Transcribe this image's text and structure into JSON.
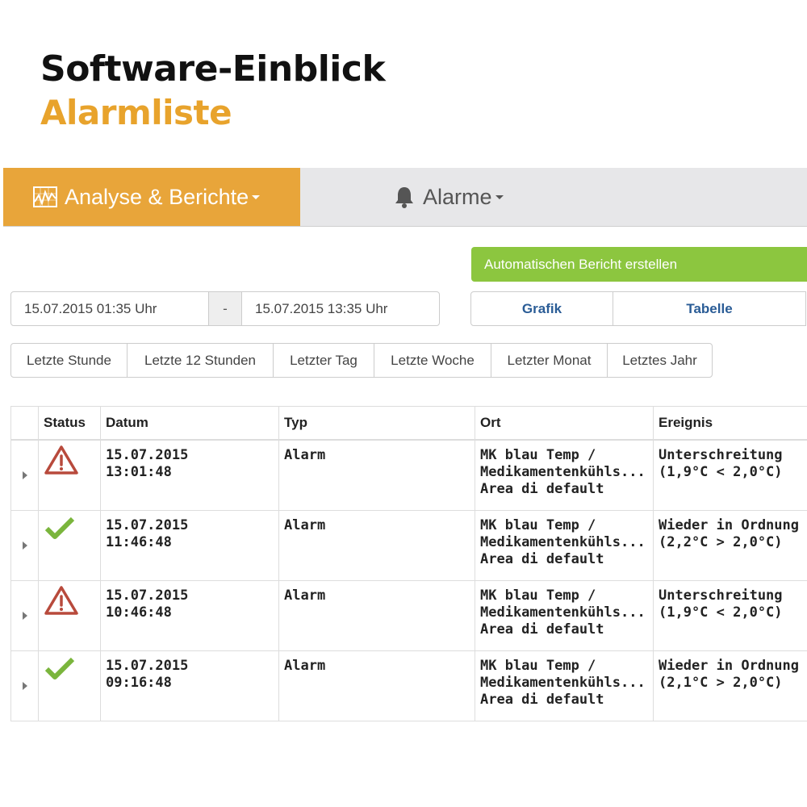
{
  "heading": {
    "title": "Software-Einblick",
    "subtitle": "Alarmliste"
  },
  "colors": {
    "accent": "#e8a53a",
    "green": "#8cc63f",
    "warning": "#b84a3c",
    "ok": "#7ab53c",
    "link": "#2a5c96"
  },
  "nav": {
    "analyse": {
      "label": "Analyse & Berichte",
      "icon": "chart-icon"
    },
    "alarme": {
      "label": "Alarme",
      "icon": "bell-icon"
    }
  },
  "report_button": "Automatischen Bericht erstellen",
  "date_range": {
    "from": "15.07.2015 01:35 Uhr",
    "separator": "-",
    "to": "15.07.2015 13:35 Uhr"
  },
  "view_toggle": {
    "grafik": "Grafik",
    "tabelle": "Tabelle"
  },
  "ranges": [
    "Letzte Stunde",
    "Letzte 12 Stunden",
    "Letzter Tag",
    "Letzte Woche",
    "Letzter Monat",
    "Letztes Jahr"
  ],
  "table": {
    "headers": {
      "status": "Status",
      "datum": "Datum",
      "typ": "Typ",
      "ort": "Ort",
      "ereignis": "Ereignis"
    },
    "rows": [
      {
        "status": "warning-icon",
        "date": "15.07.2015",
        "time": "13:01:48",
        "typ": "Alarm",
        "ort1": "MK blau Temp /",
        "ort2": "Medikamentenkühls...",
        "ort3": "Area di default",
        "ev1": "Unterschreitung",
        "ev2": "(1,9°C < 2,0°C)"
      },
      {
        "status": "checkmark-icon",
        "date": "15.07.2015",
        "time": "11:46:48",
        "typ": "Alarm",
        "ort1": "MK blau Temp /",
        "ort2": "Medikamentenkühls...",
        "ort3": "Area di default",
        "ev1": "Wieder in Ordnung",
        "ev2": "(2,2°C > 2,0°C)"
      },
      {
        "status": "warning-icon",
        "date": "15.07.2015",
        "time": "10:46:48",
        "typ": "Alarm",
        "ort1": "MK blau Temp /",
        "ort2": "Medikamentenkühls...",
        "ort3": "Area di default",
        "ev1": "Unterschreitung",
        "ev2": "(1,9°C < 2,0°C)"
      },
      {
        "status": "checkmark-icon",
        "date": "15.07.2015",
        "time": "09:16:48",
        "typ": "Alarm",
        "ort1": "MK blau Temp /",
        "ort2": "Medikamentenkühls...",
        "ort3": "Area di default",
        "ev1": "Wieder in Ordnung",
        "ev2": "(2,1°C > 2,0°C)"
      }
    ]
  }
}
